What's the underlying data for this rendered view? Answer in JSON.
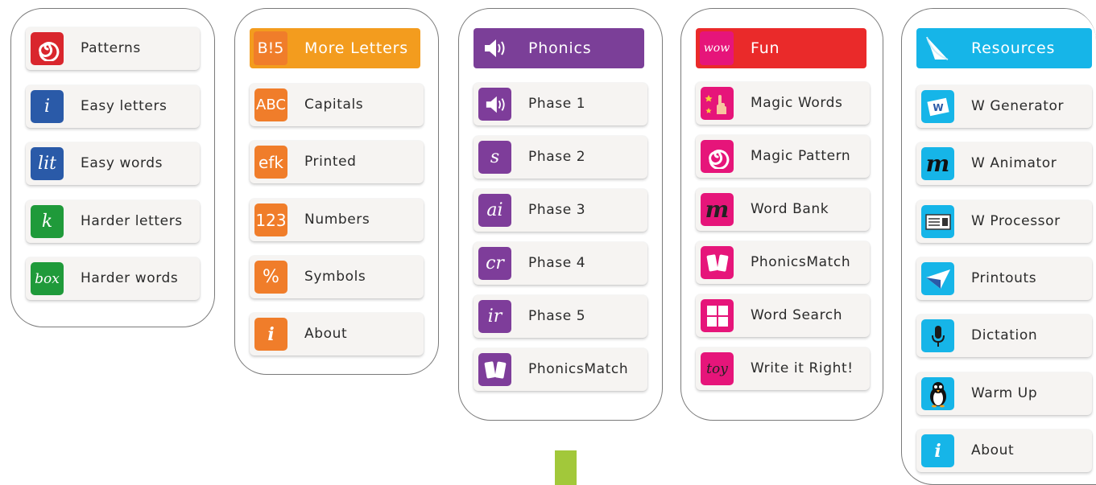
{
  "colors": {
    "patterns_red": "#d9262d",
    "blue": "#2a5aa8",
    "green": "#1f9a3a",
    "orange_head": "#f39c1e",
    "orange": "#f07d2a",
    "purple": "#7b3f98",
    "purple_icon": "#7e3d9a",
    "fun_red": "#ea2a2a",
    "pink": "#e6157a",
    "cyan": "#16b5e8",
    "green_bar": "#a2c83a"
  },
  "col1": {
    "items": [
      {
        "label": "Patterns",
        "icon": "spiral-icon"
      },
      {
        "label": "Easy letters",
        "icon": "letter-i-icon",
        "glyph": "i"
      },
      {
        "label": "Easy words",
        "icon": "lit-icon",
        "glyph": "lit"
      },
      {
        "label": "Harder letters",
        "icon": "letter-k-icon",
        "glyph": "k"
      },
      {
        "label": "Harder words",
        "icon": "box-icon",
        "glyph": "box"
      }
    ]
  },
  "col2": {
    "header": {
      "label": "More Letters",
      "glyph": "B!5"
    },
    "items": [
      {
        "label": "Capitals",
        "glyph": "ABC"
      },
      {
        "label": "Printed",
        "glyph": "efk"
      },
      {
        "label": "Numbers",
        "glyph": "123"
      },
      {
        "label": "Symbols",
        "glyph": "%"
      },
      {
        "label": "About",
        "glyph": "i"
      }
    ]
  },
  "col3": {
    "header": {
      "label": "Phonics",
      "icon": "speaker-icon"
    },
    "items": [
      {
        "label": "Phase 1",
        "icon": "speaker-icon"
      },
      {
        "label": "Phase 2",
        "glyph": "s"
      },
      {
        "label": "Phase 3",
        "glyph": "ai"
      },
      {
        "label": "Phase 4",
        "glyph": "cr"
      },
      {
        "label": "Phase 5",
        "glyph": "ir"
      },
      {
        "label": "PhonicsMatch",
        "icon": "cards-icon"
      }
    ]
  },
  "col4": {
    "header": {
      "label": "Fun",
      "glyph": "wow"
    },
    "items": [
      {
        "label": "Magic Words",
        "icon": "magic-hand-icon"
      },
      {
        "label": "Magic Pattern",
        "icon": "spiral-icon"
      },
      {
        "label": "Word Bank",
        "glyph": "m"
      },
      {
        "label": "PhonicsMatch",
        "icon": "cards-icon"
      },
      {
        "label": "Word Search",
        "icon": "grid-icon"
      },
      {
        "label": "Write it Right!",
        "glyph": "toy"
      }
    ]
  },
  "col5": {
    "header": {
      "label": "Resources",
      "icon": "page-curl-icon"
    },
    "items": [
      {
        "label": "W Generator",
        "icon": "w-sheet-icon",
        "glyph": "W"
      },
      {
        "label": "W Animator",
        "glyph": "m"
      },
      {
        "label": "W Processor",
        "icon": "document-icon"
      },
      {
        "label": "Printouts",
        "icon": "paper-plane-icon"
      },
      {
        "label": "Dictation",
        "icon": "microphone-icon"
      },
      {
        "label": "Warm Up",
        "icon": "penguin-icon"
      },
      {
        "label": "About",
        "glyph": "i"
      }
    ]
  }
}
